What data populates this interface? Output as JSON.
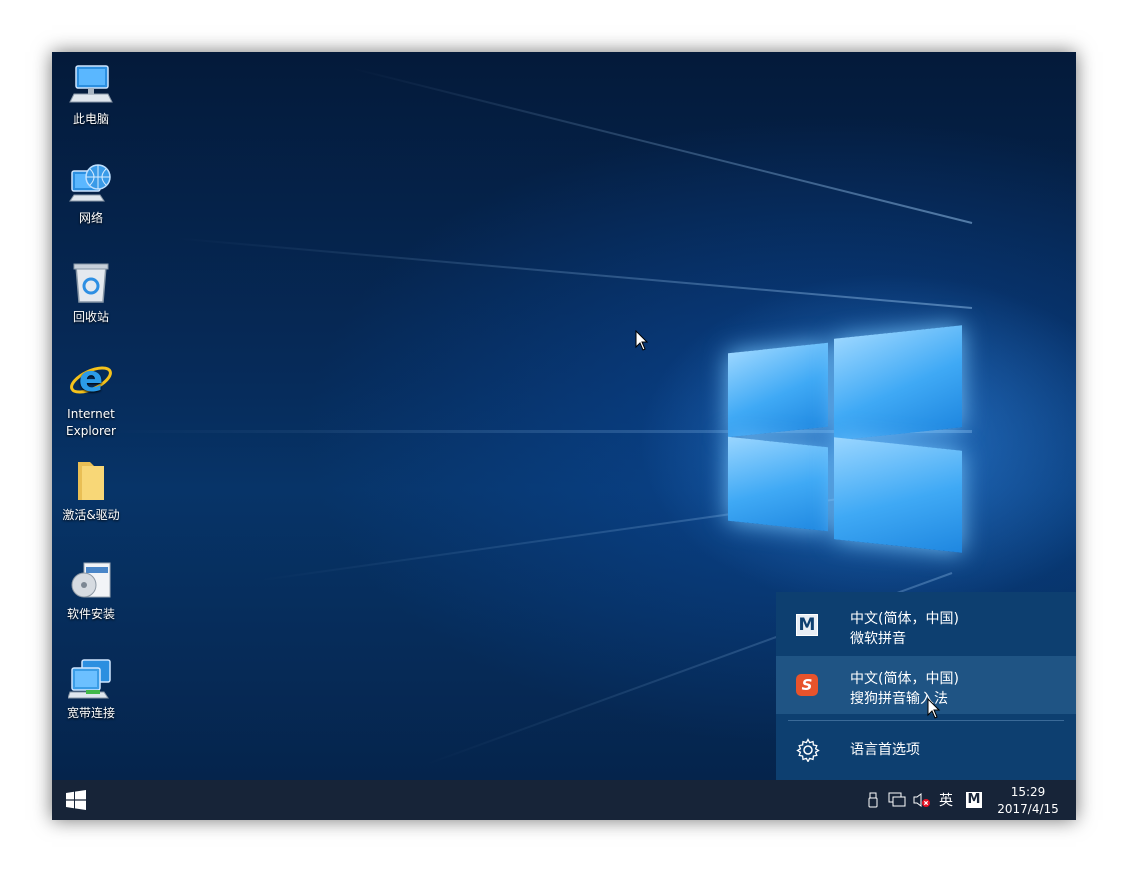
{
  "desktop_icons": [
    {
      "name": "此电脑",
      "icon": "computer-icon"
    },
    {
      "name": "网络",
      "icon": "network-icon"
    },
    {
      "name": "回收站",
      "icon": "recycle-bin-icon"
    },
    {
      "name": "Internet\nExplorer",
      "icon": "internet-explorer-icon"
    },
    {
      "name": "激活&驱动",
      "icon": "folder-icon"
    },
    {
      "name": "软件安装",
      "icon": "software-install-icon"
    },
    {
      "name": "宽带连接",
      "icon": "broadband-icon"
    }
  ],
  "ime_menu": {
    "items": [
      {
        "line1": "中文(简体，中国)",
        "line2": "微软拼音",
        "icon": "microsoft-pinyin-icon",
        "icon_text": "M"
      },
      {
        "line1": "中文(简体，中国)",
        "line2": "搜狗拼音输入法",
        "icon": "sogou-icon",
        "icon_text": "S"
      }
    ],
    "preferences_label": "语言首选项"
  },
  "taskbar": {
    "ime_mode": "英",
    "ime_indicator": "M",
    "time": "15:29",
    "date": "2017/4/15"
  },
  "colors": {
    "taskbar": "#172438",
    "ime_panel": "#0d3f70",
    "ime_highlight": "#1f5484",
    "accent": "#3fa9f5"
  }
}
